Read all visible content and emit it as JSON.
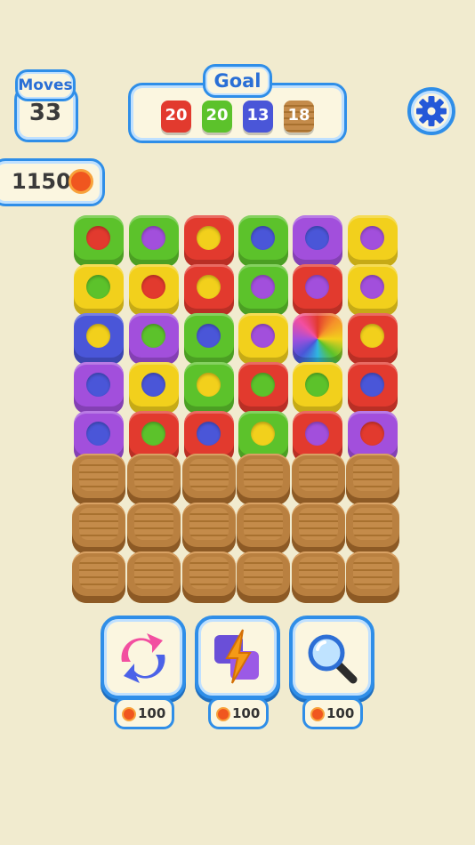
{
  "moves": {
    "label": "Moves",
    "value": "33"
  },
  "goal": {
    "label": "Goal",
    "items": [
      {
        "count": "20",
        "color": "#e23a2e",
        "kind": "red"
      },
      {
        "count": "20",
        "color": "#5cc22b",
        "kind": "green"
      },
      {
        "count": "13",
        "color": "#4a56d8",
        "kind": "blue"
      },
      {
        "count": "18",
        "color": "#b98040",
        "kind": "wood"
      }
    ]
  },
  "coins": {
    "value": "1150"
  },
  "settings": {
    "icon": "gear-icon"
  },
  "board": {
    "colors": {
      "red": "#e23a2e",
      "green": "#5cc22b",
      "yellow": "#f2d01c",
      "blue": "#4a56d8",
      "purple": "#a24fdc"
    },
    "rows": [
      [
        [
          "green",
          "red"
        ],
        [
          "green",
          "purple"
        ],
        [
          "red",
          "yellow"
        ],
        [
          "green",
          "blue"
        ],
        [
          "purple",
          "blue"
        ],
        [
          "yellow",
          "purple"
        ]
      ],
      [
        [
          "yellow",
          "green"
        ],
        [
          "yellow",
          "red"
        ],
        [
          "red",
          "yellow"
        ],
        [
          "green",
          "purple"
        ],
        [
          "red",
          "purple"
        ],
        [
          "yellow",
          "purple"
        ]
      ],
      [
        [
          "blue",
          "yellow"
        ],
        [
          "purple",
          "green"
        ],
        [
          "green",
          "blue"
        ],
        [
          "yellow",
          "purple"
        ],
        [
          "rainbow",
          "rainbow"
        ],
        [
          "red",
          "yellow"
        ]
      ],
      [
        [
          "purple",
          "blue"
        ],
        [
          "yellow",
          "blue"
        ],
        [
          "green",
          "yellow"
        ],
        [
          "red",
          "green"
        ],
        [
          "yellow",
          "green"
        ],
        [
          "red",
          "blue"
        ]
      ],
      [
        [
          "purple",
          "blue"
        ],
        [
          "red",
          "green"
        ],
        [
          "red",
          "blue"
        ],
        [
          "green",
          "yellow"
        ],
        [
          "red",
          "purple"
        ],
        [
          "purple",
          "red"
        ]
      ]
    ],
    "wood_rows": 3
  },
  "boosters": [
    {
      "name": "shuffle",
      "icon": "shuffle-arrows-icon",
      "price": "100"
    },
    {
      "name": "lightning",
      "icon": "lightning-icon",
      "price": "100"
    },
    {
      "name": "magnifier",
      "icon": "magnifier-icon",
      "price": "100"
    }
  ]
}
